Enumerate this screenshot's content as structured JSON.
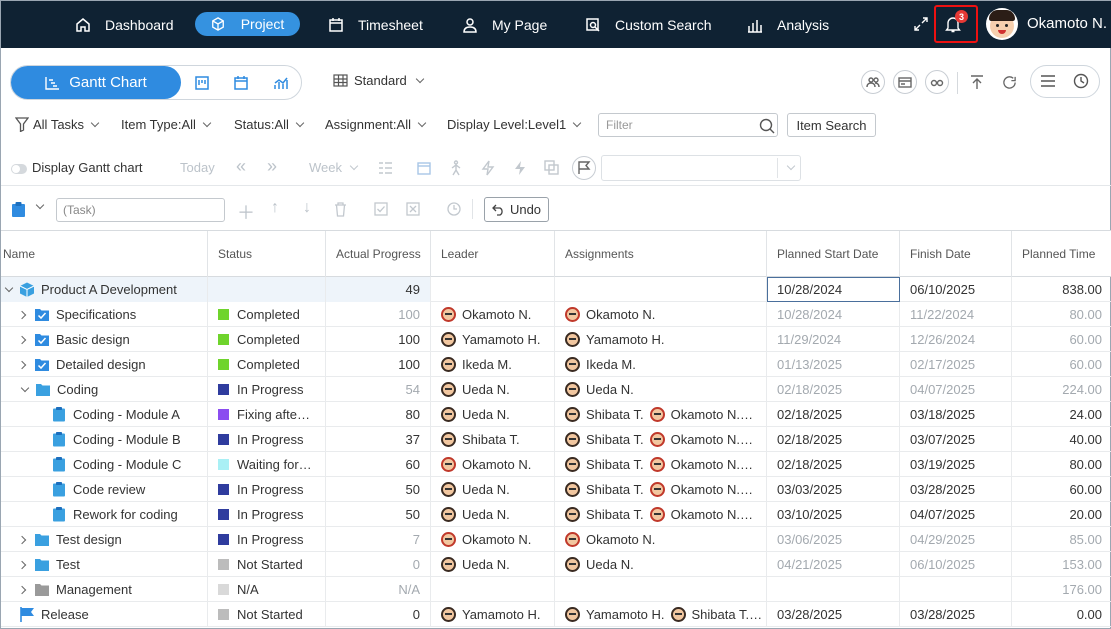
{
  "nav": {
    "items": [
      {
        "label": "Dashboard"
      },
      {
        "label": "Project"
      },
      {
        "label": "Timesheet"
      },
      {
        "label": "My Page"
      },
      {
        "label": "Custom Search"
      },
      {
        "label": "Analysis"
      }
    ],
    "notification_count": "3",
    "user_name": "Okamoto N."
  },
  "view": {
    "gantt_label": "Gantt Chart",
    "layout_label": "Standard"
  },
  "filters": {
    "all_tasks": "All Tasks",
    "item_type": "Item Type:All",
    "status": "Status:All",
    "assignment": "Assignment:All",
    "display_level": "Display Level:Level1",
    "filter_placeholder": "Filter",
    "item_search": "Item Search"
  },
  "gantt_controls": {
    "display_gantt": "Display Gantt chart",
    "today": "Today",
    "week": "Week"
  },
  "task_bar": {
    "task_placeholder": "(Task)",
    "undo": "Undo"
  },
  "columns": [
    "Name",
    "Status",
    "Actual Progress",
    "Leader",
    "Assignments",
    "Planned Start Date",
    "Finish Date",
    "Planned Time"
  ],
  "status_colors": {
    "Completed": "#6fd42c",
    "In Progress": "#2f3c9e",
    "Fixing": "#8b4df0",
    "Waiting": "#a9f0f5",
    "Not Started": "#bcbcbc",
    "N/A": "#d9d9d9"
  },
  "rows": [
    {
      "name": "Product A Development",
      "status": "",
      "progress": "49",
      "leader": "",
      "assignments": [],
      "start": "10/28/2024",
      "finish": "06/10/2025",
      "time": "838.00"
    },
    {
      "name": "Specifications",
      "status": "Completed",
      "progress": "100",
      "leader": "Okamoto N.",
      "assignments": [
        "Okamoto N."
      ],
      "start": "10/28/2024",
      "finish": "11/22/2024",
      "time": "80.00"
    },
    {
      "name": "Basic design",
      "status": "Completed",
      "progress": "100",
      "leader": "Yamamoto H.",
      "assignments": [
        "Yamamoto H."
      ],
      "start": "11/29/2024",
      "finish": "12/26/2024",
      "time": "60.00"
    },
    {
      "name": "Detailed design",
      "status": "Completed",
      "progress": "100",
      "leader": "Ikeda M.",
      "assignments": [
        "Ikeda M."
      ],
      "start": "01/13/2025",
      "finish": "02/17/2025",
      "time": "60.00"
    },
    {
      "name": "Coding",
      "status": "In Progress",
      "progress": "54",
      "leader": "Ueda N.",
      "assignments": [
        "Ueda N."
      ],
      "start": "02/18/2025",
      "finish": "04/07/2025",
      "time": "224.00"
    },
    {
      "name": "Coding - Module A",
      "status": "Fixing afte…",
      "progress": "80",
      "leader": "Ueda N.",
      "assignments": [
        "Shibata T.",
        "Okamoto N.…"
      ],
      "start": "02/18/2025",
      "finish": "03/18/2025",
      "time": "24.00"
    },
    {
      "name": "Coding - Module B",
      "status": "In Progress",
      "progress": "37",
      "leader": "Shibata T.",
      "assignments": [
        "Shibata T.",
        "Okamoto N.…"
      ],
      "start": "02/18/2025",
      "finish": "03/07/2025",
      "time": "40.00"
    },
    {
      "name": "Coding - Module C",
      "status": "Waiting for…",
      "progress": "60",
      "leader": "Okamoto N.",
      "assignments": [
        "Shibata T.",
        "Okamoto N.…"
      ],
      "start": "02/18/2025",
      "finish": "03/19/2025",
      "time": "80.00"
    },
    {
      "name": "Code review",
      "status": "In Progress",
      "progress": "50",
      "leader": "Ueda N.",
      "assignments": [
        "Shibata T.",
        "Okamoto N.…"
      ],
      "start": "03/03/2025",
      "finish": "03/28/2025",
      "time": "60.00"
    },
    {
      "name": "Rework for coding",
      "status": "In Progress",
      "progress": "50",
      "leader": "Ueda N.",
      "assignments": [
        "Shibata T.",
        "Okamoto N.…"
      ],
      "start": "03/10/2025",
      "finish": "04/07/2025",
      "time": "20.00"
    },
    {
      "name": "Test design",
      "status": "In Progress",
      "progress": "7",
      "leader": "Okamoto N.",
      "assignments": [
        "Okamoto N."
      ],
      "start": "03/06/2025",
      "finish": "04/29/2025",
      "time": "85.00"
    },
    {
      "name": "Test",
      "status": "Not Started",
      "progress": "0",
      "leader": "Ueda N.",
      "assignments": [
        "Ueda N."
      ],
      "start": "04/21/2025",
      "finish": "06/10/2025",
      "time": "153.00"
    },
    {
      "name": "Management",
      "status": "N/A",
      "progress": "N/A",
      "leader": "",
      "assignments": [],
      "start": "",
      "finish": "",
      "time": "176.00"
    },
    {
      "name": "Release",
      "status": "Not Started",
      "progress": "0",
      "leader": "Yamamoto H.",
      "assignments": [
        "Yamamoto H.",
        "Shibata T.…"
      ],
      "start": "03/28/2025",
      "finish": "03/28/2025",
      "time": "0.00"
    }
  ]
}
